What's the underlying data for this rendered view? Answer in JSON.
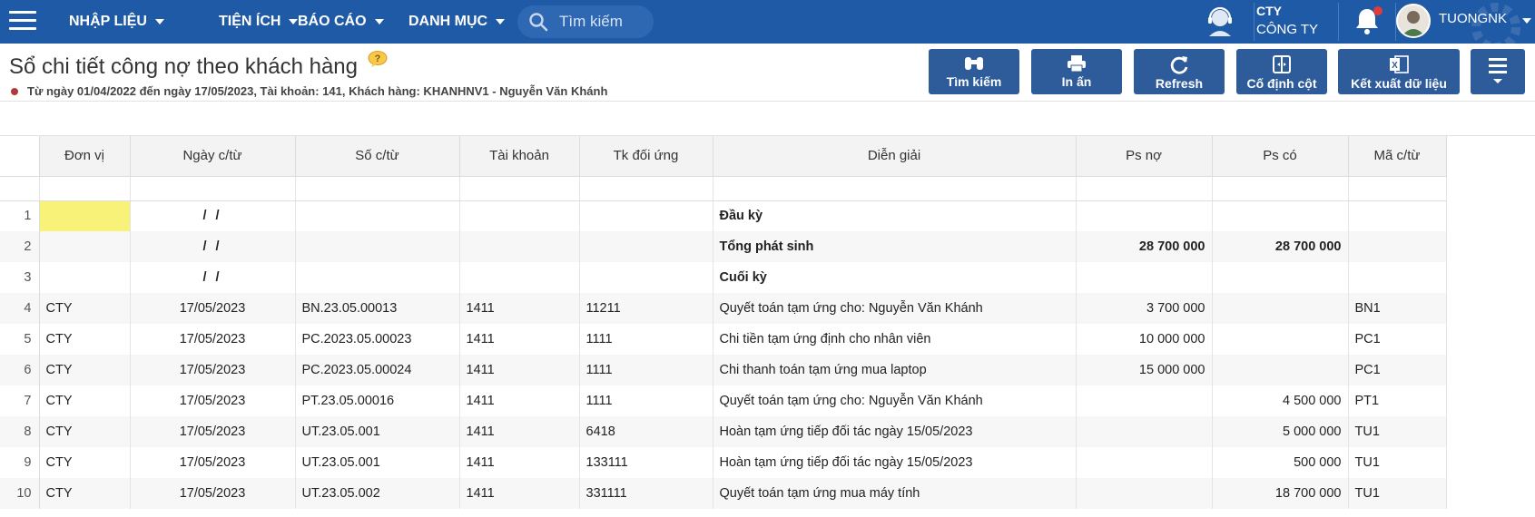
{
  "nav": {
    "menus": [
      {
        "label": "NHẬP LIỆU"
      },
      {
        "label": "TIỆN ÍCH"
      },
      {
        "label": "BÁO CÁO"
      },
      {
        "label": "DANH MỤC"
      }
    ],
    "search_placeholder": "Tìm kiếm",
    "company_code": "CTY",
    "company_name": "CÔNG TY",
    "username": "TUONGNK"
  },
  "page": {
    "title": "Sổ chi tiết công nợ theo khách hàng",
    "subtitle": "Từ ngày 01/04/2022 đến ngày 17/05/2023, Tài khoản: 141, Khách hàng: KHANHNV1 - Nguyễn Văn Khánh"
  },
  "toolbar": [
    {
      "label": "Tìm kiếm",
      "icon": "binoculars-icon"
    },
    {
      "label": "In ấn",
      "icon": "printer-icon"
    },
    {
      "label": "Refresh",
      "icon": "refresh-icon"
    },
    {
      "label": "Cố định cột",
      "icon": "freeze-columns-icon"
    },
    {
      "label": "Kết xuất dữ liệu",
      "icon": "excel-icon"
    }
  ],
  "grid": {
    "columns": [
      "Đơn vị",
      "Ngày c/từ",
      "Số c/từ",
      "Tài khoản",
      "Tk đối ứng",
      "Diễn giải",
      "Ps nợ",
      "Ps có",
      "Mã c/từ"
    ],
    "rows": [
      {
        "n": "1",
        "dv": "",
        "ngay": "/ /",
        "so": "",
        "tk": "",
        "tkdu": "",
        "dg": "Đầu kỳ",
        "no": "",
        "co": "",
        "ma": ""
      },
      {
        "n": "2",
        "dv": "",
        "ngay": "/ /",
        "so": "",
        "tk": "",
        "tkdu": "",
        "dg": "Tổng phát sinh",
        "no": "28 700 000",
        "co": "28 700 000",
        "ma": ""
      },
      {
        "n": "3",
        "dv": "",
        "ngay": "/ /",
        "so": "",
        "tk": "",
        "tkdu": "",
        "dg": "Cuối kỳ",
        "no": "",
        "co": "",
        "ma": ""
      },
      {
        "n": "4",
        "dv": "CTY",
        "ngay": "17/05/2023",
        "so": "BN.23.05.00013",
        "tk": "1411",
        "tkdu": "11211",
        "dg": "Quyết toán tạm ứng cho: Nguyễn Văn Khánh",
        "no": "3 700 000",
        "co": "",
        "ma": "BN1"
      },
      {
        "n": "5",
        "dv": "CTY",
        "ngay": "17/05/2023",
        "so": "PC.2023.05.00023",
        "tk": "1411",
        "tkdu": "1111",
        "dg": "Chi tiền tạm ứng định cho nhân viên",
        "no": "10 000 000",
        "co": "",
        "ma": "PC1"
      },
      {
        "n": "6",
        "dv": "CTY",
        "ngay": "17/05/2023",
        "so": "PC.2023.05.00024",
        "tk": "1411",
        "tkdu": "1111",
        "dg": "Chi thanh toán tạm ứng mua laptop",
        "no": "15 000 000",
        "co": "",
        "ma": "PC1"
      },
      {
        "n": "7",
        "dv": "CTY",
        "ngay": "17/05/2023",
        "so": "PT.23.05.00016",
        "tk": "1411",
        "tkdu": "1111",
        "dg": "Quyết toán tạm ứng cho: Nguyễn Văn Khánh",
        "no": "",
        "co": "4 500 000",
        "ma": "PT1"
      },
      {
        "n": "8",
        "dv": "CTY",
        "ngay": "17/05/2023",
        "so": "UT.23.05.001",
        "tk": "1411",
        "tkdu": "6418",
        "dg": "Hoàn tạm ứng tiếp đối tác ngày 15/05/2023",
        "no": "",
        "co": "5 000 000",
        "ma": "TU1"
      },
      {
        "n": "9",
        "dv": "CTY",
        "ngay": "17/05/2023",
        "so": "UT.23.05.001",
        "tk": "1411",
        "tkdu": "133111",
        "dg": "Hoàn tạm ứng tiếp đối tác ngày 15/05/2023",
        "no": "",
        "co": "500 000",
        "ma": "TU1"
      },
      {
        "n": "10",
        "dv": "CTY",
        "ngay": "17/05/2023",
        "so": "UT.23.05.002",
        "tk": "1411",
        "tkdu": "331111",
        "dg": "Quyết toán tạm ứng mua máy tính",
        "no": "",
        "co": "18 700 000",
        "ma": "TU1"
      }
    ]
  },
  "colors": {
    "topbar": "#1f5aa6",
    "button": "#2e5c9a",
    "highlight": "#f8f378"
  }
}
